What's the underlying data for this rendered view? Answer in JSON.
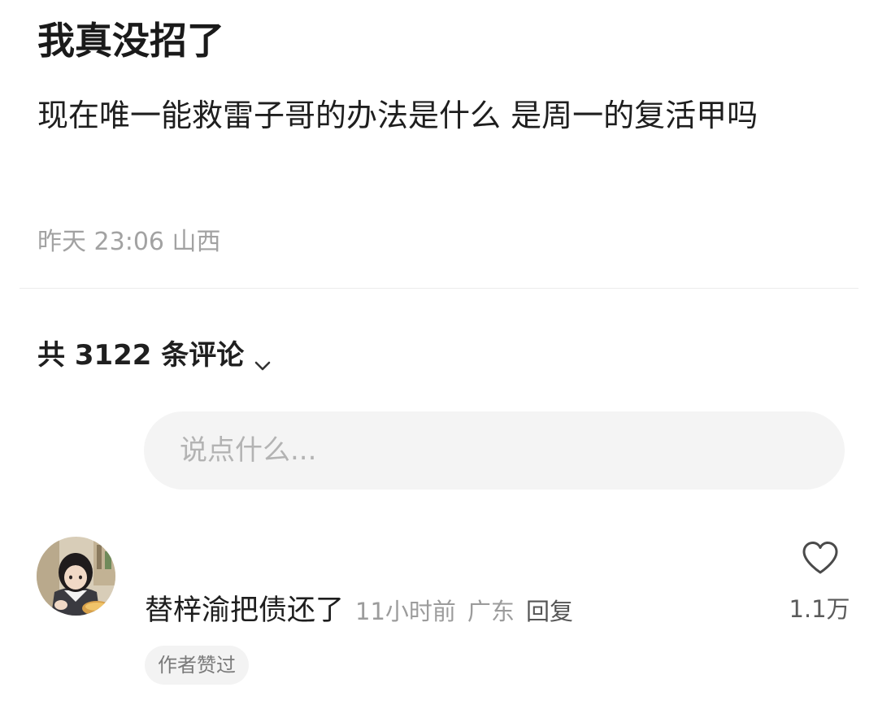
{
  "post": {
    "title": "我真没招了",
    "body": "现在唯一能救雷子哥的办法是什么  是周一的复活甲吗",
    "timestamp": "昨天 23:06",
    "location": "山西"
  },
  "comments_section": {
    "header": "共 3122 条评论",
    "input_placeholder": "说点什么..."
  },
  "comments": [
    {
      "text": "替梓渝把债还了",
      "time": "11小时前",
      "location": "广东",
      "reply_label": "回复",
      "likes": "1.1万",
      "badge": "作者赞过",
      "icons": {
        "like": "heart-outline-icon",
        "avatar": "user-avatar"
      }
    }
  ],
  "colors": {
    "meta_gray": "#a2a2a2",
    "input_background": "#f4f4f4",
    "divider": "#ececec"
  }
}
